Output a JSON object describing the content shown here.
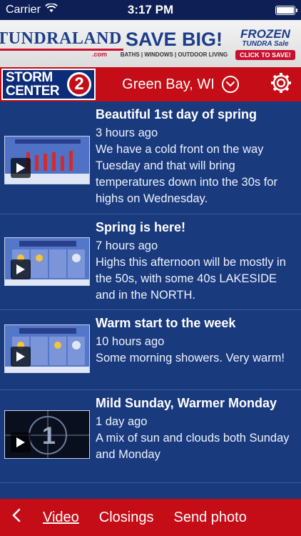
{
  "status_bar": {
    "carrier": "Carrier",
    "time": "3:17 PM",
    "battery_level": 1.0
  },
  "ad": {
    "logo": "TUNDRALAND",
    "logo_sub": ".com",
    "headline": "SAVE BIG!",
    "subline": "BATHS | WINDOWS | OUTDOOR LIVING",
    "brand": "FROZEN",
    "brand_sub": "TUNDRA Sale",
    "cta": "CLICK TO SAVE!"
  },
  "header": {
    "brand_line1": "STORM",
    "brand_line2": "CENTER",
    "brand_number": "2",
    "location": "Green Bay, WI"
  },
  "feed": [
    {
      "title": "Beautiful 1st day of spring",
      "time": "3 hours ago",
      "description": "We have a cold front on the way Tuesday and that will bring temperatures down into the 30s for highs on Wednesday."
    },
    {
      "title": "Spring is here!",
      "time": "7 hours ago",
      "description": "Highs this afternoon will be mostly in the 50s, with some 40s LAKESIDE and in the NORTH."
    },
    {
      "title": "Warm start to the week",
      "time": "10 hours ago",
      "description": "Some morning showers. Very warm!"
    },
    {
      "title": "Mild Sunday, Warmer Monday",
      "time": "1 day ago",
      "description": "A mix of sun and clouds both Sunday and Monday"
    }
  ],
  "bottom_nav": {
    "video": "Video",
    "closings": "Closings",
    "send_photo": "Send photo"
  },
  "colors": {
    "header_red": "#c40d17",
    "feed_blue": "#1a3a7e",
    "status_navy": "#0d1f55"
  }
}
